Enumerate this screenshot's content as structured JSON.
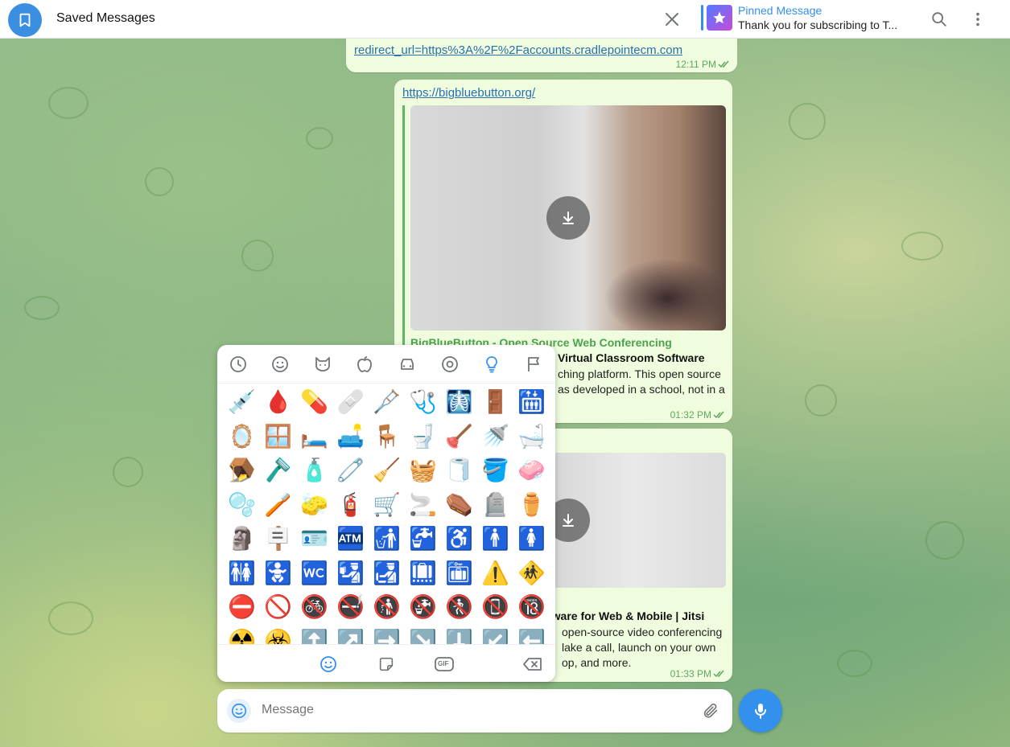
{
  "header": {
    "title": "Saved Messages",
    "pinned_label": "Pinned Message",
    "pinned_text": "Thank you for subscribing to T..."
  },
  "messages": [
    {
      "link": "redirect_url=https%3A%2F%2Faccounts.cradlepointecm.com",
      "time": "12:11 PM"
    },
    {
      "link": "https://bigbluebutton.org/",
      "site": "BigBlueButton - Open Source Web Conferencing",
      "title_fragment": "Virtual Classroom Software",
      "desc_line1": "ching platform. This open source",
      "desc_line2": "as developed in a school, not in a",
      "time": "01:32 PM"
    },
    {
      "title_fragment": "tware for Web & Mobile | Jitsi",
      "desc_line1": "open-source video conferencing",
      "desc_line2": "lake a call, launch on your own",
      "desc_line3": "op, and more.",
      "time": "01:33 PM"
    }
  ],
  "emoji_panel": {
    "tabs": [
      "recent-icon",
      "smileys-icon",
      "animals-icon",
      "food-icon",
      "travel-icon",
      "activities-icon",
      "objects-icon",
      "flags-icon"
    ],
    "active_tab": "objects-icon",
    "emojis": [
      "💉",
      "🩸",
      "💊",
      "🩹",
      "🩼",
      "🩺",
      "🩻",
      "🚪",
      "🛗",
      "🪞",
      "🪟",
      "🛏️",
      "🛋️",
      "🪑",
      "🚽",
      "🪠",
      "🚿",
      "🛁",
      "🪤",
      "🪒",
      "🧴",
      "🧷",
      "🧹",
      "🧺",
      "🧻",
      "🪣",
      "🧼",
      "🫧",
      "🪥",
      "🧽",
      "🧯",
      "🛒",
      "🚬",
      "⚰️",
      "🪦",
      "⚱️",
      "🗿",
      "🪧",
      "🪪",
      "🏧",
      "🚮",
      "🚰",
      "♿",
      "🚹",
      "🚺",
      "🚻",
      "🚼",
      "🚾",
      "🛂",
      "🛃",
      "🛄",
      "🛅",
      "⚠️",
      "🚸",
      "⛔",
      "🚫",
      "🚳",
      "🚭",
      "🚯",
      "🚱",
      "🚷",
      "📵",
      "🔞",
      "☢️",
      "☣️",
      "⬆️",
      "↗️",
      "➡️",
      "↘️",
      "⬇️",
      "↙️",
      "⬅️"
    ],
    "bottom_tabs": [
      "emoji-tab",
      "sticker-tab",
      "gif-tab",
      "backspace"
    ],
    "gif_label": "GIF"
  },
  "composer": {
    "placeholder": "Message"
  },
  "colors": {
    "accent": "#3390ec",
    "bubble": "#effdde",
    "link": "#2a6fb0",
    "preview_green": "#4da24f"
  }
}
